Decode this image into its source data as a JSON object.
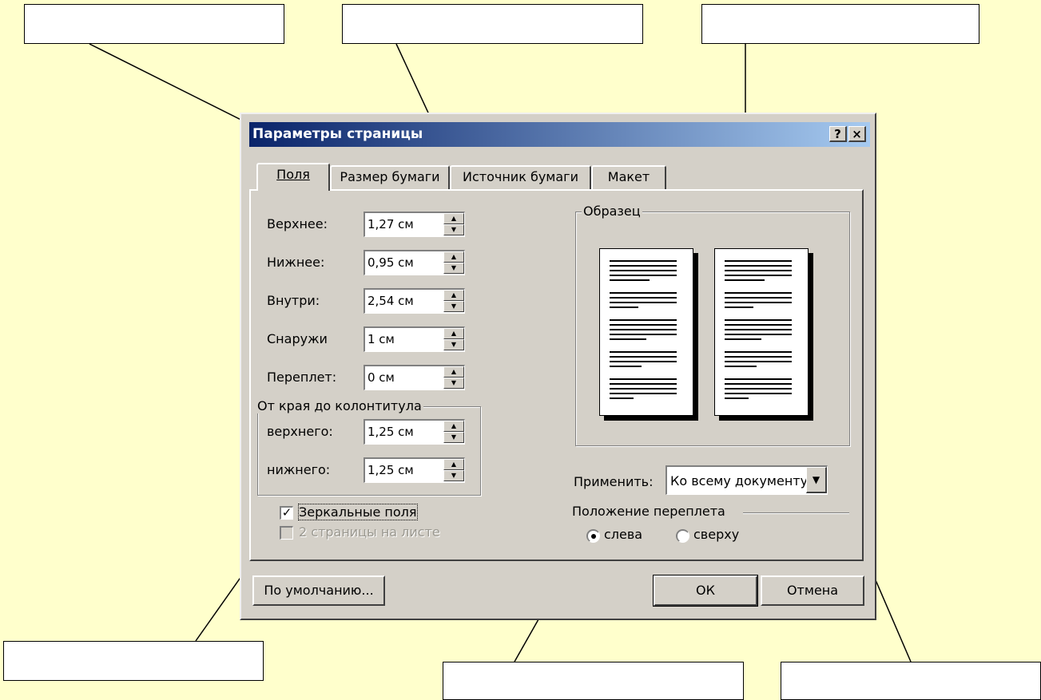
{
  "dialog": {
    "title": "Параметры страницы",
    "help_button": "?",
    "close_button": "×",
    "tabs": [
      {
        "label": "Поля",
        "active": true
      },
      {
        "label": "Размер бумаги",
        "active": false
      },
      {
        "label": "Источник бумаги",
        "active": false
      },
      {
        "label": "Макет",
        "active": false
      }
    ],
    "margins": {
      "top_label": "Верхнее:",
      "top_value": "1,27 см",
      "bottom_label": "Нижнее:",
      "bottom_value": "0,95 см",
      "inside_label": "Внутри:",
      "inside_value": "2,54 см",
      "outside_label": "Снаружи",
      "outside_value": "1 см",
      "gutter_label": "Переплет:",
      "gutter_value": "0 см"
    },
    "header_footer": {
      "group_title": "От края до колонтитула",
      "header_label": "верхнего:",
      "header_value": "1,25 см",
      "footer_label": "нижнего:",
      "footer_value": "1,25 см"
    },
    "mirror_margins": {
      "label": "Зеркальные поля",
      "checked": true
    },
    "two_pages": {
      "label": "2 страницы на листе",
      "checked": false,
      "disabled": true
    },
    "preview": {
      "group_title": "Образец"
    },
    "apply": {
      "label": "Применить:",
      "value": "Ко всему документу"
    },
    "gutter_position": {
      "group_title": "Положение переплета",
      "left_label": "слева",
      "top_label": "сверху",
      "selected": "left"
    },
    "buttons": {
      "default": "По умолчанию...",
      "ok": "ОК",
      "cancel": "Отмена"
    }
  },
  "colors": {
    "background": "#ffffcc",
    "dialog_face": "#d4d0c8",
    "title_start": "#0a246a",
    "title_end": "#a6caf0"
  }
}
